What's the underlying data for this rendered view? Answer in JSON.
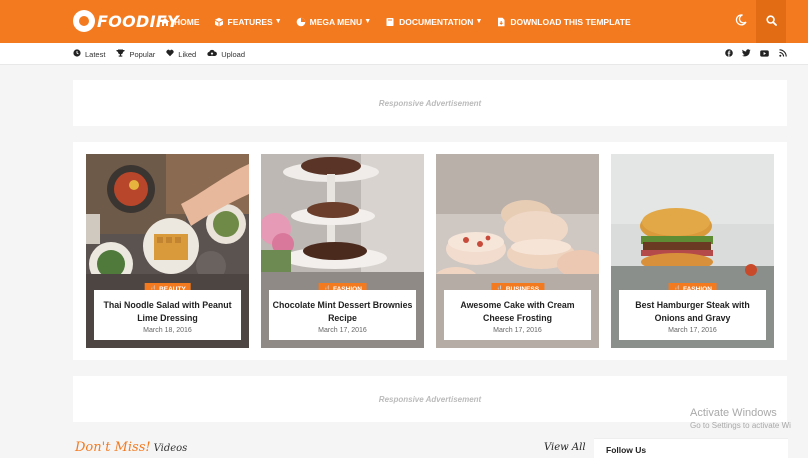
{
  "brand": {
    "logo_text": "FOODIFY"
  },
  "nav": {
    "items": [
      {
        "label": "HOME",
        "icon": "home-icon",
        "dropdown": false
      },
      {
        "label": "FEATURES",
        "icon": "cube-icon",
        "dropdown": true
      },
      {
        "label": "MEGA MENU",
        "icon": "pie-chart-icon",
        "dropdown": true
      },
      {
        "label": "DOCUMENTATION",
        "icon": "book-icon",
        "dropdown": true
      },
      {
        "label": "DOWNLOAD THIS TEMPLATE",
        "icon": "file-download-icon",
        "dropdown": false
      }
    ]
  },
  "subnav": {
    "links": [
      {
        "label": "Latest",
        "icon": "clock-icon"
      },
      {
        "label": "Popular",
        "icon": "trophy-icon"
      },
      {
        "label": "Liked",
        "icon": "heart-icon"
      },
      {
        "label": "Upload",
        "icon": "cloud-upload-icon"
      }
    ],
    "social": [
      "facebook-icon",
      "twitter-icon",
      "youtube-icon",
      "rss-icon"
    ]
  },
  "ads": {
    "top": "Responsive Advertisement",
    "middle": "Responsive Advertisement"
  },
  "featured": [
    {
      "tag": "BEAUTY",
      "title": "Thai Noodle Salad with Peanut Lime Dressing",
      "date": "March 18, 2016"
    },
    {
      "tag": "FASHION",
      "title": "Chocolate Mint Dessert Brownies Recipe",
      "date": "March 17, 2016"
    },
    {
      "tag": "BUSINESS",
      "title": "Awesome Cake with Cream Cheese Frosting",
      "date": "March 17, 2016"
    },
    {
      "tag": "FASHION",
      "title": "Best Hamburger Steak with Onions and Gravy",
      "date": "March 17, 2016"
    }
  ],
  "section": {
    "heading": "Don't Miss!",
    "subheading": "Videos",
    "view_all": "View All"
  },
  "sidebar": {
    "follow_title": "Follow Us"
  },
  "watermark": {
    "line1": "Activate Windows",
    "line2": "Go to Settings to activate Wi"
  },
  "colors": {
    "accent": "#f47a20"
  }
}
